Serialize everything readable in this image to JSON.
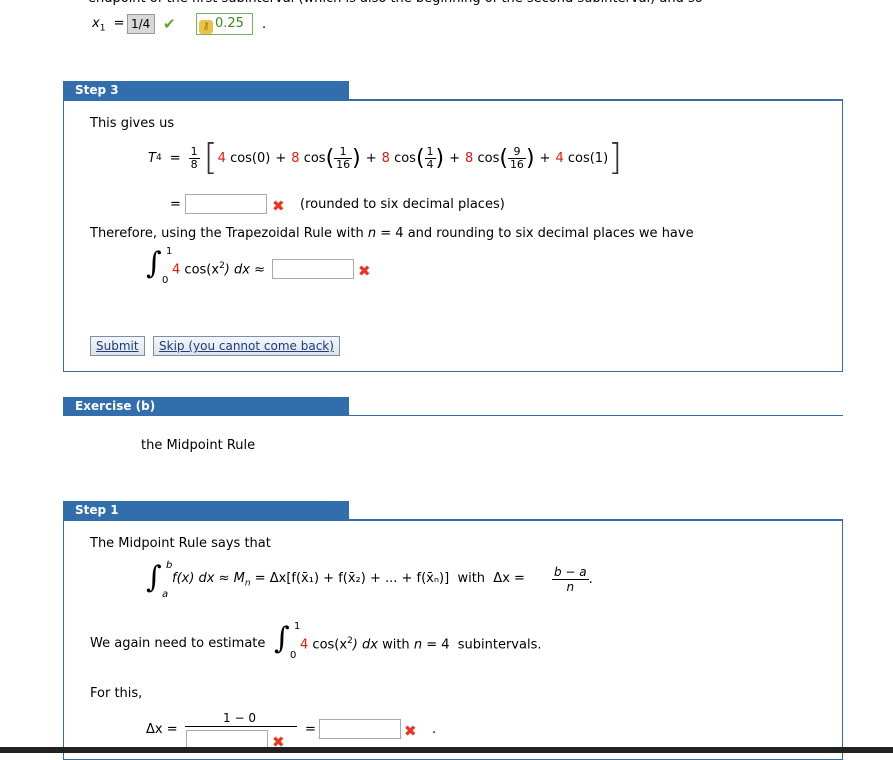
{
  "top": {
    "cut_text": "endpoint of the first subinterval (which is also the beginning of the second subinterval) and so",
    "x1_label": "x",
    "x1_sub": "1",
    "equals": "=",
    "x1_value": "1/4",
    "check_icon": "check-icon",
    "key_value": "0.25",
    "period": "."
  },
  "step3": {
    "tab_label": "Step 3",
    "intro": "This gives us",
    "T_label": "T",
    "T_sub": "4",
    "frac_num": "1",
    "frac_den": "8",
    "terms": [
      {
        "coef": "4",
        "func": "cos(0)"
      },
      {
        "coef": "8",
        "func": "cos",
        "num": "1",
        "den": "16"
      },
      {
        "coef": "8",
        "func": "cos",
        "num": "1",
        "den": "4"
      },
      {
        "coef": "8",
        "func": "cos",
        "num": "9",
        "den": "16"
      },
      {
        "coef": "4",
        "func": "cos(1)"
      }
    ],
    "plus": "+",
    "rounded_note": "(rounded to six decimal places)",
    "input1_value": "",
    "therefore_text_a": "Therefore, using the Trapezoidal Rule with ",
    "therefore_n": "n",
    "therefore_text_b": " = 4 and rounding to six decimal places we have",
    "integral_upper": "1",
    "integral_lower": "0",
    "integrand_coef": "4",
    "integrand": "cos(x",
    "integrand_exp": "2",
    "integrand_close": ") dx ≈",
    "input2_value": "",
    "submit_label": "Submit",
    "skip_label": "Skip (you cannot come back)"
  },
  "exercise_b": {
    "tab_label": "Exercise (b)",
    "text": "the Midpoint Rule"
  },
  "step1": {
    "tab_label": "Step 1",
    "intro": "The Midpoint Rule says that",
    "integral_upper": "b",
    "integral_lower": "a",
    "formula": "f(x) dx ≈ M",
    "formula_sub": "n",
    "formula_rest": " = Δx[f(x̄₁) + f(x̄₂) + ... + f(x̄ₙ)]  with  Δx = ",
    "dx_num": "b − a",
    "dx_den": "n",
    "estimate_text": "We again need to estimate",
    "est_upper": "1",
    "est_lower": "0",
    "est_coef": "4",
    "est_integrand": "cos(x",
    "est_exp": "2",
    "est_close": ") dx",
    "est_with": " with ",
    "est_n": "n",
    "est_tail": " = 4  subintervals.",
    "for_this": "For this,",
    "delta_x": "Δx =",
    "dx2_num": "1 − 0",
    "dx2_den_value": "",
    "equals": "=",
    "result_value": "",
    "period": "."
  }
}
